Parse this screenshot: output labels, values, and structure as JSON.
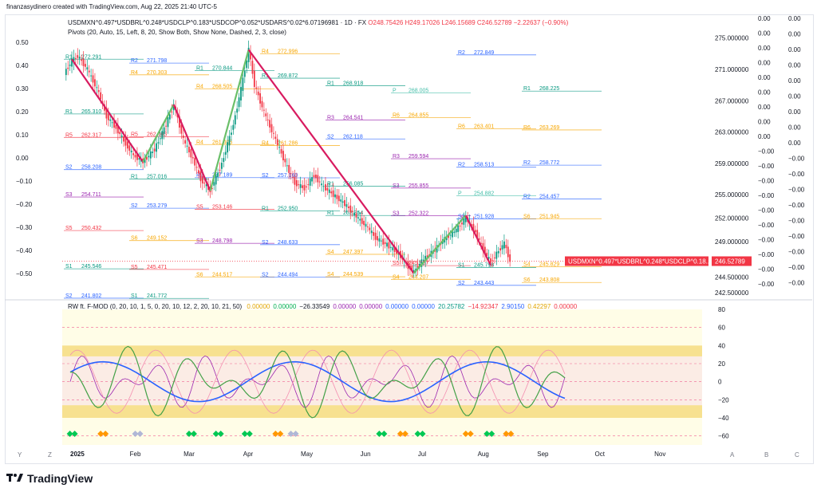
{
  "header": {
    "caption": "finanzasydinero created with TradingView.com, Aug 22, 2025 21:40 UTC-5"
  },
  "legend": {
    "symbol": "USDMXN^0.497*USDBRL^0.248*USDCLP^0.183*USDCOP^0.052*USDARS^0.02*6.07196981 · 1D · FX",
    "open": "O248.75426",
    "high": "H249.17026",
    "low": "L246.15689",
    "close": "C246.52789",
    "change": "−2.22637 (−0.90%)",
    "pivots": "Pivots (20, Auto, 15, Left, 8, 20, Show Both, Show None, Dashed, 2, 3, close)"
  },
  "oscillator": {
    "title": "RW ft. F-MOD (0, 20, 10, 1, 5, 0, 20, 10, 12, 2, 20, 10, 21, 50)",
    "values": [
      {
        "text": "0.00000",
        "color": "#e2a600"
      },
      {
        "text": "0.00000",
        "color": "#00b050"
      },
      {
        "text": "−26.33549",
        "color": "#131722"
      },
      {
        "text": "0.00000",
        "color": "#9c27b0"
      },
      {
        "text": "0.00000",
        "color": "#9c27b0"
      },
      {
        "text": "0.00000",
        "color": "#2962ff"
      },
      {
        "text": "0.00000",
        "color": "#2962ff"
      },
      {
        "text": "20.25782",
        "color": "#089981"
      },
      {
        "text": "−14.92347",
        "color": "#f23645"
      },
      {
        "text": "2.90150",
        "color": "#2962ff"
      },
      {
        "text": "0.42297",
        "color": "#e2a600"
      },
      {
        "text": "0.00000",
        "color": "#f23645"
      }
    ]
  },
  "price_axis": {
    "ticks": [
      "275.000000",
      "271.000000",
      "267.000000",
      "263.000000",
      "259.000000",
      "255.000000",
      "252.000000",
      "249.000000",
      "244.500000",
      "242.500000"
    ],
    "last_label": "USDMXN^0.497*USDBRL^0.248*USDCLP^0.18...",
    "last_value": "246.52789"
  },
  "osc_axis": {
    "ticks": [
      "80",
      "60",
      "40",
      "20",
      "0",
      "−20",
      "−40",
      "−60"
    ]
  },
  "time_axis": {
    "labels": [
      "2025",
      "Feb",
      "Mar",
      "Apr",
      "May",
      "Jun",
      "Jul",
      "Aug",
      "Sep",
      "Oct",
      "Nov"
    ]
  },
  "left_scale": {
    "ticks": [
      "0.50",
      "0.40",
      "0.30",
      "0.20",
      "0.10",
      "0.00",
      "−0.10",
      "−0.20",
      "−0.30",
      "−0.40",
      "−0.50"
    ]
  },
  "right_scale_a": {
    "ticks": [
      "0.00",
      "0.00",
      "0.00",
      "0.00",
      "0.00",
      "0.00",
      "0.00",
      "0.00",
      "0.00",
      "−0.00",
      "−0.00",
      "−0.00",
      "−0.00",
      "−0.00",
      "−0.00",
      "−0.00",
      "−0.00",
      "−0.00",
      "−0.00"
    ]
  },
  "right_scale_b": {
    "ticks": [
      "0.00",
      "0.00",
      "0.00",
      "0.00",
      "0.00",
      "0.00",
      "0.00",
      "0.00",
      "0.00",
      "−0.00",
      "−0.00",
      "−0.00",
      "−0.00",
      "−0.00",
      "−0.00",
      "−0.00",
      "−0.00",
      "−0.00"
    ]
  },
  "corner_buttons": [
    "Y",
    "Z",
    "A",
    "B",
    "C"
  ],
  "brand": "TradingView",
  "colors": {
    "up": "#089981",
    "down": "#f23645",
    "zigzag": "#d81b60",
    "zigzag_up": "#6abf69",
    "last_price_bg": "#f23645"
  },
  "chart_data": {
    "type": "candlestick",
    "series_name": "USDMXN^0.497*USDBRL^0.248*USDCLP^0.183*USDCOP^0.052*USDARS^0.02*6.07196981",
    "interval": "1D",
    "x_range": [
      "2025-01-01",
      "2025-11-30"
    ],
    "y_range": [
      242.0,
      277.0
    ],
    "closes": [
      {
        "date": "2025-01-02",
        "close": 270.5
      },
      {
        "date": "2025-01-06",
        "close": 272.1
      },
      {
        "date": "2025-01-09",
        "close": 272.7
      },
      {
        "date": "2025-01-14",
        "close": 271.0
      },
      {
        "date": "2025-01-20",
        "close": 268.0
      },
      {
        "date": "2025-01-24",
        "close": 265.0
      },
      {
        "date": "2025-01-29",
        "close": 263.5
      },
      {
        "date": "2025-02-03",
        "close": 261.5
      },
      {
        "date": "2025-02-07",
        "close": 260.0
      },
      {
        "date": "2025-02-12",
        "close": 259.2
      },
      {
        "date": "2025-02-18",
        "close": 260.8
      },
      {
        "date": "2025-02-24",
        "close": 264.0
      },
      {
        "date": "2025-02-28",
        "close": 266.5
      },
      {
        "date": "2025-03-05",
        "close": 262.0
      },
      {
        "date": "2025-03-10",
        "close": 259.5
      },
      {
        "date": "2025-03-14",
        "close": 257.0
      },
      {
        "date": "2025-03-19",
        "close": 255.5
      },
      {
        "date": "2025-03-25",
        "close": 259.0
      },
      {
        "date": "2025-03-31",
        "close": 264.0
      },
      {
        "date": "2025-04-04",
        "close": 268.5
      },
      {
        "date": "2025-04-08",
        "close": 273.5
      },
      {
        "date": "2025-04-11",
        "close": 269.0
      },
      {
        "date": "2025-04-16",
        "close": 265.5
      },
      {
        "date": "2025-04-22",
        "close": 262.0
      },
      {
        "date": "2025-04-28",
        "close": 258.5
      },
      {
        "date": "2025-05-02",
        "close": 256.5
      },
      {
        "date": "2025-05-07",
        "close": 255.8
      },
      {
        "date": "2025-05-12",
        "close": 257.5
      },
      {
        "date": "2025-05-16",
        "close": 256.2
      },
      {
        "date": "2025-05-22",
        "close": 255.0
      },
      {
        "date": "2025-05-28",
        "close": 253.8
      },
      {
        "date": "2025-06-03",
        "close": 252.2
      },
      {
        "date": "2025-06-09",
        "close": 250.8
      },
      {
        "date": "2025-06-13",
        "close": 249.5
      },
      {
        "date": "2025-06-19",
        "close": 248.6
      },
      {
        "date": "2025-06-25",
        "close": 247.5
      },
      {
        "date": "2025-06-30",
        "close": 245.8
      },
      {
        "date": "2025-07-03",
        "close": 245.2
      },
      {
        "date": "2025-07-08",
        "close": 246.8
      },
      {
        "date": "2025-07-14",
        "close": 248.0
      },
      {
        "date": "2025-07-18",
        "close": 249.2
      },
      {
        "date": "2025-07-24",
        "close": 250.3
      },
      {
        "date": "2025-07-30",
        "close": 252.0
      },
      {
        "date": "2025-08-04",
        "close": 250.2
      },
      {
        "date": "2025-08-08",
        "close": 248.0
      },
      {
        "date": "2025-08-12",
        "close": 246.4
      },
      {
        "date": "2025-08-15",
        "close": 247.5
      },
      {
        "date": "2025-08-19",
        "close": 248.8
      },
      {
        "date": "2025-08-22",
        "close": 246.52789
      }
    ],
    "zigzag": [
      {
        "date": "2025-01-06",
        "price": 272.29
      },
      {
        "date": "2025-02-12",
        "price": 259.2
      },
      {
        "date": "2025-02-28",
        "price": 266.5
      },
      {
        "date": "2025-03-19",
        "price": 255.5
      },
      {
        "date": "2025-04-08",
        "price": 273.5
      },
      {
        "date": "2025-07-03",
        "price": 245.0
      },
      {
        "date": "2025-07-30",
        "price": 252.35
      },
      {
        "date": "2025-08-12",
        "price": 246.0
      }
    ],
    "pivot_levels": [
      {
        "label": "R1",
        "value": "272.291",
        "color": "#089981"
      },
      {
        "label": "R2",
        "value": "271.798",
        "color": "#2962ff"
      },
      {
        "label": "R1",
        "value": "270.844",
        "color": "#089981"
      },
      {
        "label": "R1",
        "value": "269.872",
        "color": "#089981"
      },
      {
        "label": "R1",
        "value": "268.918",
        "color": "#089981"
      },
      {
        "label": "P",
        "value": "268.005",
        "color": "#42bda8"
      },
      {
        "label": "R2",
        "value": "272.849",
        "color": "#2962ff"
      },
      {
        "label": "R1",
        "value": "268.225",
        "color": "#089981"
      },
      {
        "label": "R1",
        "value": "265.310",
        "color": "#089981"
      },
      {
        "label": "R4",
        "value": "270.303",
        "color": "#f7a600"
      },
      {
        "label": "R4",
        "value": "268.505",
        "color": "#f7a600"
      },
      {
        "label": "R4",
        "value": "272.996",
        "color": "#f7a600"
      },
      {
        "label": "R3",
        "value": "264.541",
        "color": "#9c27b0"
      },
      {
        "label": "R6",
        "value": "264.855",
        "color": "#f7a600"
      },
      {
        "label": "R6",
        "value": "263.401",
        "color": "#f7a600"
      },
      {
        "label": "R6",
        "value": "263.269",
        "color": "#f7a600"
      },
      {
        "label": "R5",
        "value": "262.317",
        "color": "#f23645"
      },
      {
        "label": "R5",
        "value": "262.403",
        "color": "#f23645"
      },
      {
        "label": "R4",
        "value": "261.405",
        "color": "#f7a600"
      },
      {
        "label": "R4",
        "value": "261.286",
        "color": "#f7a600"
      },
      {
        "label": "S2",
        "value": "262.118",
        "color": "#2962ff"
      },
      {
        "label": "R3",
        "value": "259.594",
        "color": "#9c27b0"
      },
      {
        "label": "R2",
        "value": "258.513",
        "color": "#2962ff"
      },
      {
        "label": "R2",
        "value": "258.772",
        "color": "#2962ff"
      },
      {
        "label": "S2",
        "value": "258.208",
        "color": "#2962ff"
      },
      {
        "label": "R1",
        "value": "257.016",
        "color": "#089981"
      },
      {
        "label": "R2",
        "value": "257.189",
        "color": "#2962ff"
      },
      {
        "label": "S2",
        "value": "257.160",
        "color": "#2962ff"
      },
      {
        "label": "R1",
        "value": "256.085",
        "color": "#089981"
      },
      {
        "label": "S3",
        "value": "255.855",
        "color": "#9c27b0"
      },
      {
        "label": "P",
        "value": "254.882",
        "color": "#42bda8"
      },
      {
        "label": "R2",
        "value": "254.457",
        "color": "#2962ff"
      },
      {
        "label": "S3",
        "value": "254.711",
        "color": "#9c27b0"
      },
      {
        "label": "S2",
        "value": "253.279",
        "color": "#2962ff"
      },
      {
        "label": "S5",
        "value": "253.146",
        "color": "#f23645"
      },
      {
        "label": "R1",
        "value": "252.950",
        "color": "#089981"
      },
      {
        "label": "R1",
        "value": "252.354",
        "color": "#089981"
      },
      {
        "label": "S3",
        "value": "252.322",
        "color": "#9c27b0"
      },
      {
        "label": "S2",
        "value": "251.928",
        "color": "#2962ff"
      },
      {
        "label": "S6",
        "value": "251.945",
        "color": "#f7a600"
      },
      {
        "label": "S5",
        "value": "250.432",
        "color": "#f23645"
      },
      {
        "label": "S6",
        "value": "249.152",
        "color": "#f7a600"
      },
      {
        "label": "S3",
        "value": "248.798",
        "color": "#9c27b0"
      },
      {
        "label": "S2",
        "value": "248.633",
        "color": "#2962ff"
      },
      {
        "label": "S4",
        "value": "247.397",
        "color": "#f7a600"
      },
      {
        "label": "S5",
        "value": "245.957",
        "color": "#f23645"
      },
      {
        "label": "S1",
        "value": "245.718",
        "color": "#089981"
      },
      {
        "label": "S4",
        "value": "245.829",
        "color": "#f7a600"
      },
      {
        "label": "S1",
        "value": "245.546",
        "color": "#089981"
      },
      {
        "label": "S5",
        "value": "245.471",
        "color": "#f23645"
      },
      {
        "label": "S6",
        "value": "244.517",
        "color": "#f7a600"
      },
      {
        "label": "S2",
        "value": "244.494",
        "color": "#2962ff"
      },
      {
        "label": "S4",
        "value": "244.539",
        "color": "#f7a600"
      },
      {
        "label": "S4",
        "value": "244.207",
        "color": "#f7a600"
      },
      {
        "label": "S2",
        "value": "243.443",
        "color": "#2962ff"
      },
      {
        "label": "S6",
        "value": "243.808",
        "color": "#f7a600"
      },
      {
        "label": "S2",
        "value": "241.802",
        "color": "#2962ff"
      },
      {
        "label": "S1",
        "value": "241.772",
        "color": "#089981"
      }
    ],
    "oscillator_range": [
      -70,
      80
    ],
    "oscillator_bands": {
      "upper": [
        28,
        40
      ],
      "lower": [
        -40,
        -26
      ]
    }
  }
}
